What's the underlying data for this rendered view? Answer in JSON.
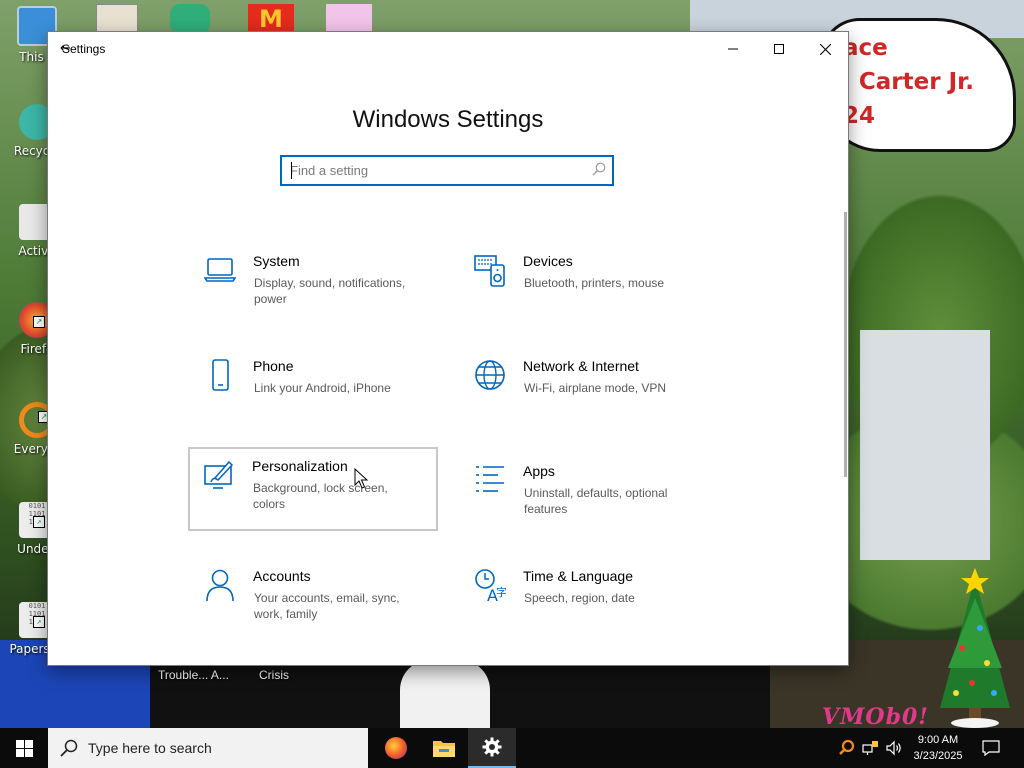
{
  "desktop": {
    "icons": [
      {
        "label": "This P",
        "name": "desktop-icon-this-pc"
      },
      {
        "label": "Recycle",
        "name": "desktop-icon-recycle-bin"
      },
      {
        "label": "Activa",
        "name": "desktop-icon-activation"
      },
      {
        "label": "Firefo",
        "name": "desktop-icon-firefox"
      },
      {
        "label": "Everyth",
        "name": "desktop-icon-everything"
      },
      {
        "label": "Underl",
        "name": "desktop-icon-underline"
      },
      {
        "label": "Papers, P",
        "name": "desktop-icon-papers"
      }
    ],
    "bottom_labels": [
      "Trouble... A...",
      "Crisis"
    ],
    "bubble_lines": [
      "ace",
      "l Carter Jr.",
      "24"
    ],
    "watermark": "VMOb0!"
  },
  "window": {
    "title": "Settings",
    "back_glyph": "←",
    "heading": "Windows Settings",
    "search_placeholder": "Find a setting",
    "tiles": [
      {
        "title": "System",
        "desc": "Display, sound, notifications, power",
        "icon": "laptop-icon"
      },
      {
        "title": "Devices",
        "desc": "Bluetooth, printers, mouse",
        "icon": "devices-icon"
      },
      {
        "title": "Phone",
        "desc": "Link your Android, iPhone",
        "icon": "phone-icon"
      },
      {
        "title": "Network & Internet",
        "desc": "Wi-Fi, airplane mode, VPN",
        "icon": "globe-icon"
      },
      {
        "title": "Personalization",
        "desc": "Background, lock screen, colors",
        "icon": "personalization-icon"
      },
      {
        "title": "Apps",
        "desc": "Uninstall, defaults, optional features",
        "icon": "apps-list-icon"
      },
      {
        "title": "Accounts",
        "desc": "Your accounts, email, sync, work, family",
        "icon": "person-icon"
      },
      {
        "title": "Time & Language",
        "desc": "Speech, region, date",
        "icon": "time-language-icon"
      }
    ]
  },
  "taskbar": {
    "search_text": "Type here to search",
    "time": "9:00 AM",
    "date": "3/23/2025",
    "accent": "#76b9ed"
  }
}
